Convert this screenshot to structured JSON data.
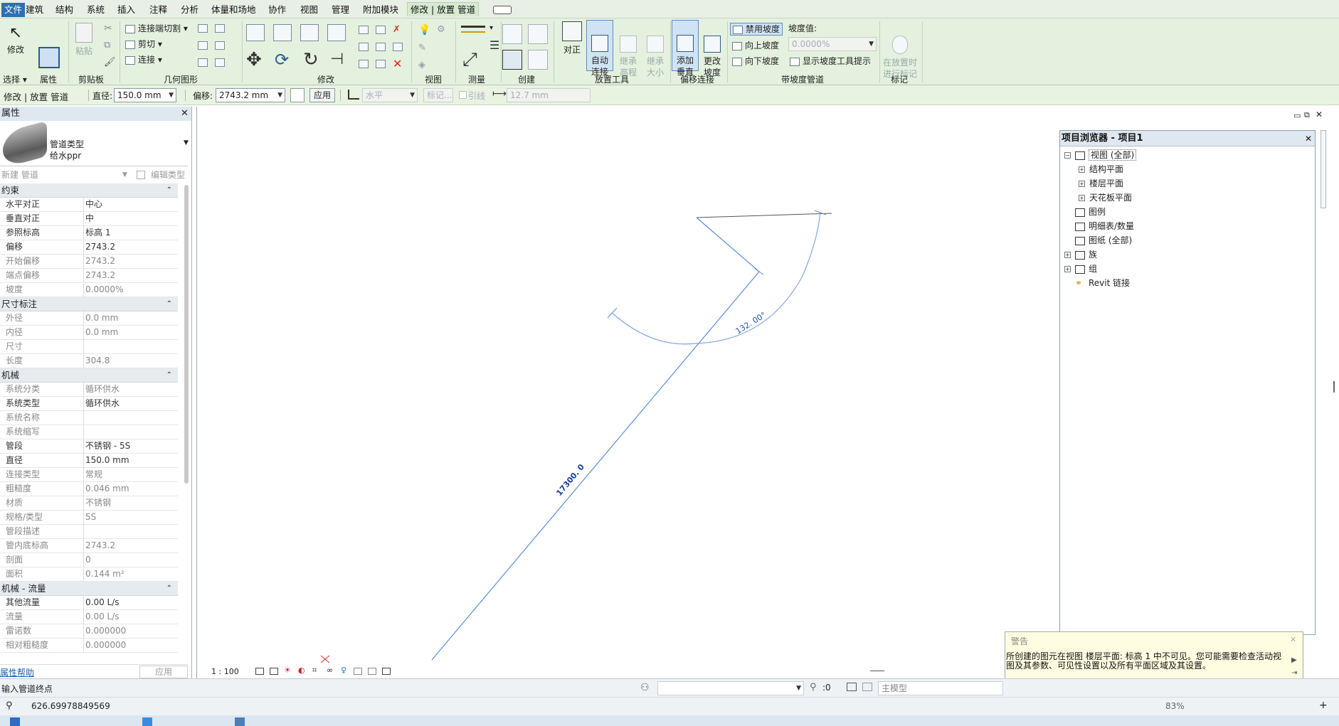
{
  "menu": {
    "items": [
      "文件",
      "建筑",
      "结构",
      "系统",
      "插入",
      "注释",
      "分析",
      "体量和场地",
      "协作",
      "视图",
      "管理",
      "附加模块",
      "修改 | 放置 管道"
    ]
  },
  "ribbon": {
    "modify_label": "修改",
    "paste_label": "粘贴",
    "cope_label": "连接端切割",
    "cut_label": "剪切",
    "join_label": "连接",
    "justify_label": "对正",
    "auto_connect_label": "自动\n连接",
    "inherit_elev_label": "继承\n高程",
    "inherit_size_label": "继承\n大小",
    "add_vertical_label": "添加\n垂直",
    "change_slope_label": "更改\n坡度",
    "disable_slope_label": "禁用坡度",
    "slope_up_label": "向上坡度",
    "slope_down_label": "向下坡度",
    "slope_value_caption": "坡度值:",
    "slope_value": "0.0000%",
    "show_slope_tool_label": "显示坡度工具提示",
    "tag_on_place_label": "在放置时\n进行标记",
    "panels": [
      "选择 ▾",
      "属性",
      "剪贴板",
      "几何图形",
      "修改",
      "视图",
      "测量",
      "创建",
      "放置工具",
      "偏移连接",
      "带坡度管道",
      "标记"
    ]
  },
  "optionbar": {
    "context": "修改 | 放置 管道",
    "diameter_caption": "直径:",
    "diameter_value": "150.0 mm",
    "offset_caption": "偏移:",
    "offset_value": "2743.2 mm",
    "apply_label": "应用",
    "orientation_value": "水平",
    "tag_label": "标记...",
    "leader_label": "引线",
    "leader_length": "12.7 mm"
  },
  "properties": {
    "title": "属性",
    "type_family": "管道类型",
    "type_name": "给水ppr",
    "new_label": "新建 管道",
    "edit_type_label": "编辑类型",
    "sections": [
      {
        "name": "约束",
        "rows": [
          {
            "k": "水平对正",
            "v": "中心",
            "grey": false
          },
          {
            "k": "垂直对正",
            "v": "中",
            "grey": false
          },
          {
            "k": "参照标高",
            "v": "标高 1",
            "grey": false
          },
          {
            "k": "偏移",
            "v": "2743.2",
            "grey": false
          },
          {
            "k": "开始偏移",
            "v": "2743.2",
            "grey": true
          },
          {
            "k": "端点偏移",
            "v": "2743.2",
            "grey": true
          },
          {
            "k": "坡度",
            "v": "0.0000%",
            "grey": true
          }
        ]
      },
      {
        "name": "尺寸标注",
        "rows": [
          {
            "k": "外径",
            "v": "0.0 mm",
            "grey": true
          },
          {
            "k": "内径",
            "v": "0.0 mm",
            "grey": true
          },
          {
            "k": "尺寸",
            "v": "",
            "grey": true
          },
          {
            "k": "长度",
            "v": "304.8",
            "grey": true
          }
        ]
      },
      {
        "name": "机械",
        "rows": [
          {
            "k": "系统分类",
            "v": "循环供水",
            "grey": true
          },
          {
            "k": "系统类型",
            "v": "循环供水",
            "grey": false
          },
          {
            "k": "系统名称",
            "v": "",
            "grey": true
          },
          {
            "k": "系统缩写",
            "v": "",
            "grey": true
          },
          {
            "k": "管段",
            "v": "不锈钢 - 5S",
            "grey": false
          },
          {
            "k": "直径",
            "v": "150.0 mm",
            "grey": false
          },
          {
            "k": "连接类型",
            "v": "常规",
            "grey": true
          },
          {
            "k": "粗糙度",
            "v": "0.046 mm",
            "grey": true
          },
          {
            "k": "材质",
            "v": "不锈钢",
            "grey": true
          },
          {
            "k": "规格/类型",
            "v": "5S",
            "grey": true
          },
          {
            "k": "管段描述",
            "v": "",
            "grey": true
          },
          {
            "k": "管内底标高",
            "v": "2743.2",
            "grey": true
          },
          {
            "k": "剖面",
            "v": "0",
            "grey": true
          },
          {
            "k": "面积",
            "v": "0.144 m²",
            "grey": true
          }
        ]
      },
      {
        "name": "机械 - 流量",
        "rows": [
          {
            "k": "其他流量",
            "v": "0.00 L/s",
            "grey": false
          },
          {
            "k": "流量",
            "v": "0.00 L/s",
            "grey": true
          },
          {
            "k": "雷诺数",
            "v": "0.000000",
            "grey": true
          },
          {
            "k": "相对粗糙度",
            "v": "0.000000",
            "grey": true
          }
        ]
      }
    ],
    "help_link": "属性帮助",
    "apply_label": "应用"
  },
  "canvas": {
    "scale": "1 : 100",
    "length_dim": "17300. 0",
    "angle_dim": "132. 00°"
  },
  "browser": {
    "title": "项目浏览器 - 项目1",
    "nodes": [
      "视图 (全部)",
      "结构平面",
      "楼层平面",
      "天花板平面",
      "图例",
      "明细表/数量",
      "图纸 (全部)",
      "族",
      "组",
      "Revit 链接"
    ]
  },
  "warning": {
    "title": "警告",
    "message": "所创建的图元在视图 楼层平面: 标高 1 中不可见。您可能需要检查活动视图及其参数、可见性设置以及所有平面区域及其设置。"
  },
  "status": {
    "prompt": "输入管道终点",
    "workset_value": ":0",
    "model_label": "主模型",
    "coordinate": "626.69978849569",
    "zoom": "83%"
  }
}
